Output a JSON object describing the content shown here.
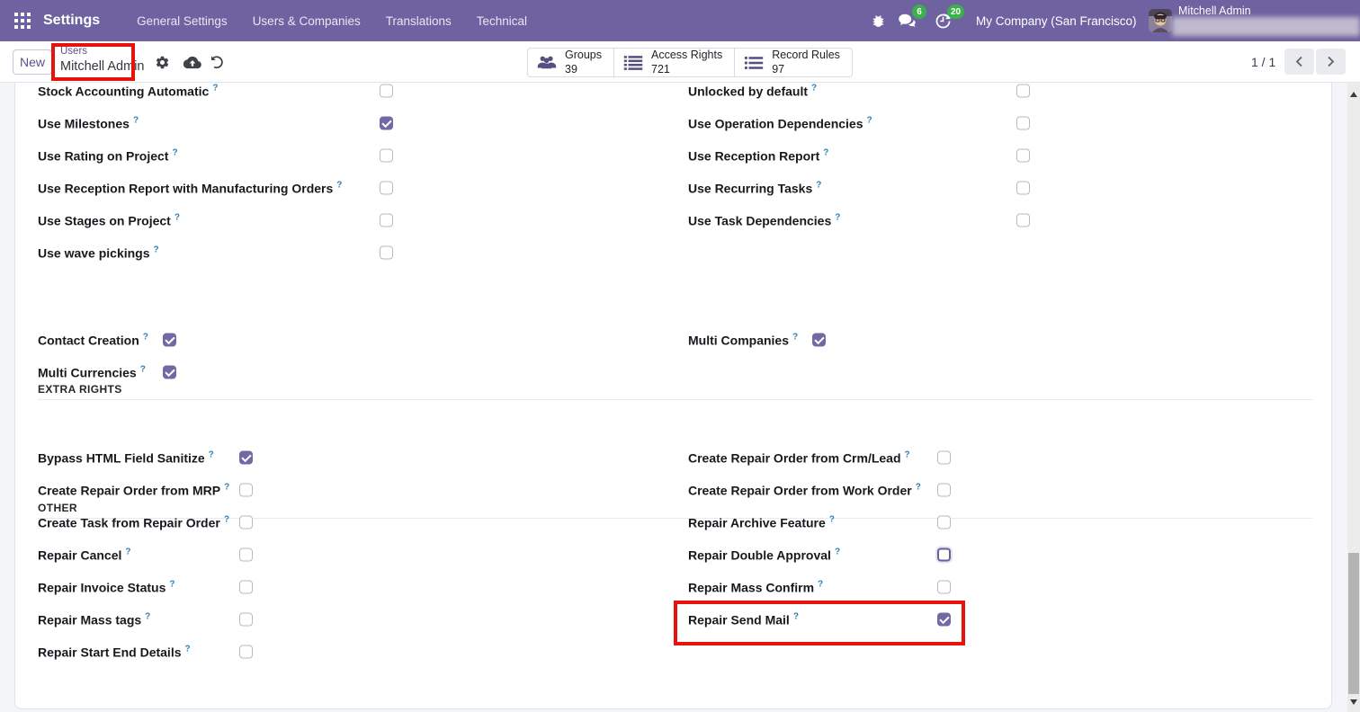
{
  "navbar": {
    "app_name": "Settings",
    "menu_items": [
      "General Settings",
      "Users & Companies",
      "Translations",
      "Technical"
    ],
    "messages_badge": "6",
    "activities_badge": "20",
    "company": "My Company (San Francisco)",
    "user_name": "Mitchell Admin"
  },
  "control_panel": {
    "new_button": "New",
    "breadcrumb": {
      "parent": "Users",
      "current": "Mitchell Admin"
    },
    "stat_buttons": [
      {
        "icon": "users-icon",
        "label": "Groups",
        "count": "39"
      },
      {
        "icon": "list-icon",
        "label": "Access Rights",
        "count": "721"
      },
      {
        "icon": "list-bullets-icon",
        "label": "Record Rules",
        "count": "97"
      }
    ],
    "pager": {
      "text": "1 / 1"
    }
  },
  "form": {
    "help_marker": "?",
    "top_left_rows": [
      {
        "label": "Stock Accounting Automatic",
        "checked": false
      },
      {
        "label": "Use Milestones",
        "checked": true
      },
      {
        "label": "Use Rating on Project",
        "checked": false
      },
      {
        "label": "Use Reception Report with Manufacturing Orders",
        "checked": false
      },
      {
        "label": "Use Stages on Project",
        "checked": false
      },
      {
        "label": "Use wave pickings",
        "checked": false
      }
    ],
    "top_right_rows": [
      {
        "label": "Unlocked by default",
        "checked": false
      },
      {
        "label": "Use Operation Dependencies",
        "checked": false
      },
      {
        "label": "Use Reception Report",
        "checked": false
      },
      {
        "label": "Use Recurring Tasks",
        "checked": false
      },
      {
        "label": "Use Task Dependencies",
        "checked": false
      }
    ],
    "sections": [
      {
        "title": "EXTRA RIGHTS",
        "left": [
          {
            "label": "Contact Creation",
            "checked": true
          },
          {
            "label": "Multi Currencies",
            "checked": true
          }
        ],
        "right": [
          {
            "label": "Multi Companies",
            "checked": true
          }
        ]
      },
      {
        "title": "OTHER",
        "left": [
          {
            "label": "Bypass HTML Field Sanitize",
            "checked": true
          },
          {
            "label": "Create Repair Order from MRP",
            "checked": false
          },
          {
            "label": "Create Task from Repair Order",
            "checked": false
          },
          {
            "label": "Repair Cancel",
            "checked": false
          },
          {
            "label": "Repair Invoice Status",
            "checked": false
          },
          {
            "label": "Repair Mass tags",
            "checked": false
          },
          {
            "label": "Repair Start End Details",
            "checked": false
          }
        ],
        "right": [
          {
            "label": "Create Repair Order from Crm/Lead",
            "checked": false
          },
          {
            "label": "Create Repair Order from Work Order",
            "checked": false
          },
          {
            "label": "Repair Archive Feature",
            "checked": false
          },
          {
            "label": "Repair Double Approval",
            "checked": false,
            "focused": true
          },
          {
            "label": "Repair Mass Confirm",
            "checked": false
          },
          {
            "label": "Repair Send Mail",
            "checked": true,
            "highlighted": true
          }
        ]
      }
    ]
  },
  "colors": {
    "navbar_purple": "#6e62a0",
    "checkbox_purple": "#7368a4",
    "badge_green": "#3cb04d",
    "annotation_red": "#e5130c",
    "help_blue": "#2e81b8"
  }
}
